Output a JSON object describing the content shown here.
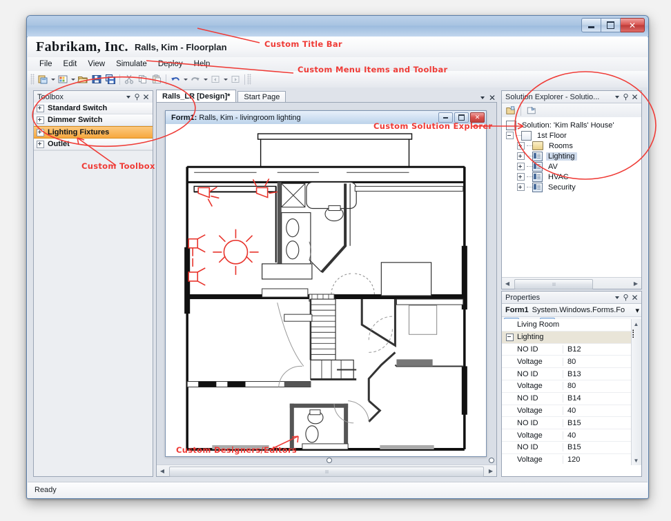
{
  "window": {
    "buttons": {
      "minimize": "minimize-icon",
      "maximize": "maximize-icon",
      "close": "✕"
    }
  },
  "app": {
    "brand": "Fabrikam, Inc.",
    "document_name": "Ralls, Kim - Floorplan"
  },
  "menu": {
    "items": [
      "File",
      "Edit",
      "View",
      "Simulate",
      "Deploy",
      "Help"
    ]
  },
  "toolbar": {
    "buttons": [
      "new-project-icon",
      "new-item-icon",
      "open-icon",
      "save-icon",
      "save-all-icon",
      "cut-icon",
      "copy-icon",
      "paste-icon",
      "undo-icon",
      "redo-icon",
      "navigate-backward-icon",
      "navigate-forward-icon"
    ]
  },
  "toolbox": {
    "title": "Toolbox",
    "items": [
      {
        "label": "Standard Switch",
        "selected": false
      },
      {
        "label": "Dimmer Switch",
        "selected": false
      },
      {
        "label": "Lighting Fixtures",
        "selected": true
      },
      {
        "label": "Outlet",
        "selected": false
      }
    ],
    "selected_color": "#f7a83f"
  },
  "document_tabs": [
    {
      "label": "Ralls_LR [Design]*",
      "active": true
    },
    {
      "label": "Start Page",
      "active": false
    }
  ],
  "designer": {
    "form": {
      "title_bold": "Form1:",
      "title_rest": "Ralls, Kim - livingroom lighting"
    }
  },
  "solution_explorer": {
    "title": "Solution Explorer - Solutio...",
    "toolbar_buttons": [
      "properties-icon",
      "show-all-files-icon"
    ],
    "tree": [
      {
        "label": "Solution: 'Kim Ralls' House'",
        "level": 0,
        "icon": "solution-icon",
        "expander": "none",
        "selected": false
      },
      {
        "label": "1st Floor",
        "level": 1,
        "icon": "solution-icon",
        "expander": "minus",
        "selected": false
      },
      {
        "label": "Rooms",
        "level": 2,
        "icon": "folder-icon",
        "expander": "plus",
        "selected": false
      },
      {
        "label": "Lighting",
        "level": 2,
        "icon": "file-icon",
        "expander": "plus",
        "selected": true
      },
      {
        "label": "AV",
        "level": 2,
        "icon": "file-icon",
        "expander": "plus",
        "selected": false
      },
      {
        "label": "HVAC",
        "level": 2,
        "icon": "file-icon",
        "expander": "plus",
        "selected": false
      },
      {
        "label": "Security",
        "level": 2,
        "icon": "file-icon",
        "expander": "plus",
        "selected": false
      }
    ]
  },
  "properties": {
    "title": "Properties",
    "object_name": "Form1",
    "object_type": "System.Windows.Forms.Fo",
    "toolbar_buttons": [
      "categorized-icon",
      "alphabetical-icon",
      "properties-page-icon",
      "events-icon",
      "property-pages-icon"
    ],
    "rows": [
      {
        "kind": "plain",
        "key": "Living Room",
        "value": ""
      },
      {
        "kind": "category",
        "key": "Lighting",
        "value": ""
      },
      {
        "kind": "row",
        "key": "NO ID",
        "value": "B12"
      },
      {
        "kind": "row",
        "key": "Voltage",
        "value": "80"
      },
      {
        "kind": "row",
        "key": "NO ID",
        "value": "B13"
      },
      {
        "kind": "row",
        "key": "Voltage",
        "value": "80"
      },
      {
        "kind": "row",
        "key": "NO ID",
        "value": "B14"
      },
      {
        "kind": "row",
        "key": "Voltage",
        "value": "40"
      },
      {
        "kind": "row",
        "key": "NO ID",
        "value": "B15"
      },
      {
        "kind": "row",
        "key": "Voltage",
        "value": "40"
      },
      {
        "kind": "row",
        "key": "NO ID",
        "value": "B15"
      },
      {
        "kind": "row",
        "key": "Voltage",
        "value": "120"
      }
    ]
  },
  "status": {
    "text": "Ready"
  },
  "annotations": [
    {
      "id": "title-bar",
      "text": "Custom Title Bar"
    },
    {
      "id": "menu-toolbar",
      "text": "Custom Menu Items and Toolbar"
    },
    {
      "id": "toolbox",
      "text": "Custom Toolbox"
    },
    {
      "id": "solution-explorer",
      "text": "Custom Solution Explorer"
    },
    {
      "id": "designers",
      "text": "Custom Designers/Editors"
    }
  ],
  "annotation_color": "#ef3b36"
}
